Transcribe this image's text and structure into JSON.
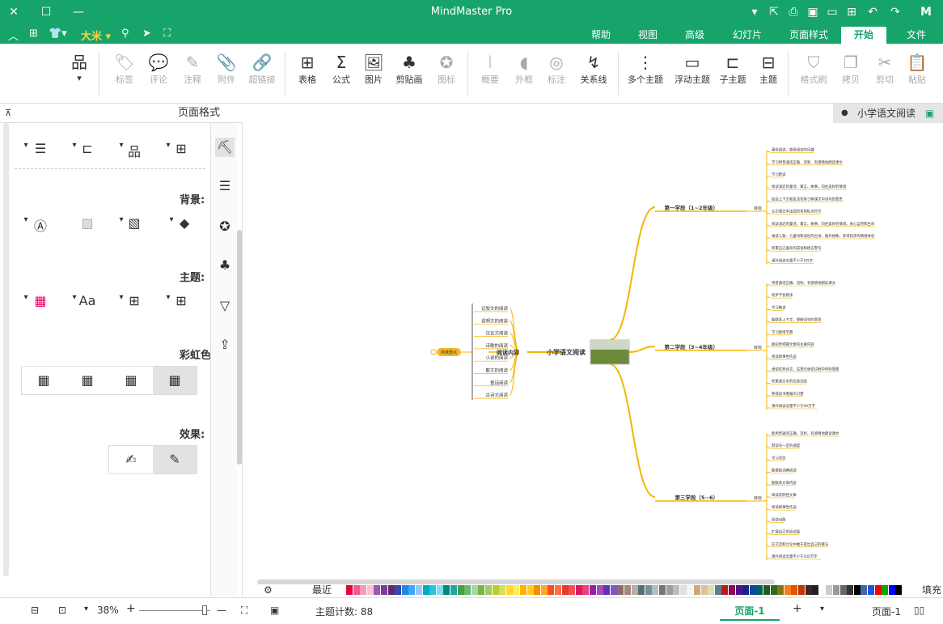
{
  "window": {
    "title": "MindMaster Pro"
  },
  "menu": {
    "tabs": [
      "文件",
      "开始",
      "页面样式",
      "幻灯片",
      "高级",
      "视图",
      "帮助"
    ],
    "active_tab": "开始",
    "font_label": "大米"
  },
  "ribbon": {
    "buttons": [
      {
        "label": "粘贴",
        "icon": "paste-icon"
      },
      {
        "label": "剪切",
        "icon": "cut-icon"
      },
      {
        "label": "拷贝",
        "icon": "copy-icon"
      },
      {
        "label": "格式刷",
        "icon": "format-painter-icon"
      },
      {
        "label": "主题",
        "icon": "topic-icon"
      },
      {
        "label": "子主题",
        "icon": "subtopic-icon"
      },
      {
        "label": "浮动主题",
        "icon": "floating-topic-icon"
      },
      {
        "label": "多个主题",
        "icon": "multiple-topics-icon"
      },
      {
        "label": "关系线",
        "icon": "relationship-icon"
      },
      {
        "label": "标注",
        "icon": "callout-icon"
      },
      {
        "label": "外框",
        "icon": "boundary-icon"
      },
      {
        "label": "概要",
        "icon": "summary-icon"
      },
      {
        "label": "图标",
        "icon": "icon-icon"
      },
      {
        "label": "剪贴画",
        "icon": "clipart-icon"
      },
      {
        "label": "图片",
        "icon": "image-icon"
      },
      {
        "label": "公式",
        "icon": "formula-icon"
      },
      {
        "label": "表格",
        "icon": "table-icon"
      },
      {
        "label": "超链接",
        "icon": "hyperlink-icon"
      },
      {
        "label": "附件",
        "icon": "attachment-icon"
      },
      {
        "label": "注释",
        "icon": "note-icon"
      },
      {
        "label": "评论",
        "icon": "comment-icon"
      },
      {
        "label": "标签",
        "icon": "tag-icon"
      }
    ]
  },
  "document_tab": {
    "name": "小学语文阅读"
  },
  "left_panel": {
    "title": "页面格式",
    "sections": {
      "background": "背景:",
      "theme": "主题:",
      "rainbow": "彩虹色:",
      "effect": "效果:"
    }
  },
  "mindmap": {
    "central": "小学语文阅读",
    "left_main": "阅读内容",
    "left_sub_tag": "阅读重点",
    "left_items": [
      "记叙文的阅读",
      "说明文的阅读",
      "议论文阅读",
      "诗歌的阅读",
      "小说的阅读",
      "散文的阅读",
      "童话阅读",
      "古诗文阅读"
    ],
    "branches": [
      {
        "label": "第一学段（1~2年级）",
        "sub": "目标",
        "items": [
          "喜欢阅读，感受阅读的乐趣",
          "学习用普通话正确、流利、有感情地朗读课文",
          "学习默读",
          "阅读浅近的童话、寓言、故事，向往美好的情境",
          "结合上下文和生活实际了解课文中词句的意思",
          "认识课文中出现的常用标点符号",
          "阅读浅近的童话、寓言、故事，向往美好的情境，关心自然和生命",
          "诵读儿歌、儿童诗和浅近的古诗，展开想象，获得初步的情感体验",
          "积累自己喜欢的成语和格言警句",
          "课外阅读总量不少于5万字"
        ]
      },
      {
        "label": "第二学段（3~4年级）",
        "sub": "目标",
        "items": [
          "用普通话正确、流利、有感情地朗读课文",
          "初步学会默读",
          "学习略读",
          "能联系上下文，理解词句的意思",
          "学习使用字典",
          "能初步把握文章的主要内容",
          "阅读叙事性作品",
          "诵读优秀诗文，注意在诵读过程中体验情感",
          "积累课文中的优美词语",
          "养成读书看报的习惯",
          "课外阅读总量不少于40万字"
        ]
      },
      {
        "label": "第三学段（5~6）",
        "sub": "目标",
        "items": [
          "能用普通话正确、流利、有感情地朗读课文",
          "默读有一定的速度",
          "学习浏览",
          "能借助词典阅读",
          "能联系文章内容",
          "阅读说明性文章",
          "阅读叙事性作品",
          "阅读诗歌",
          "扩展自己的阅读面",
          "在交流和讨论中敢于提出自己的看法",
          "课外阅读总量不少于100万字"
        ]
      }
    ]
  },
  "status": {
    "page_label": "页面-1",
    "page_tab": "页面-1",
    "topic_count_label": "主题计数: 88",
    "zoom": "38%",
    "fill_label": "填充",
    "recent_label": "最近"
  },
  "colors": {
    "brand": "#17a46a",
    "branch_line": "#f5b400",
    "accent_tag": "#f6b822"
  }
}
